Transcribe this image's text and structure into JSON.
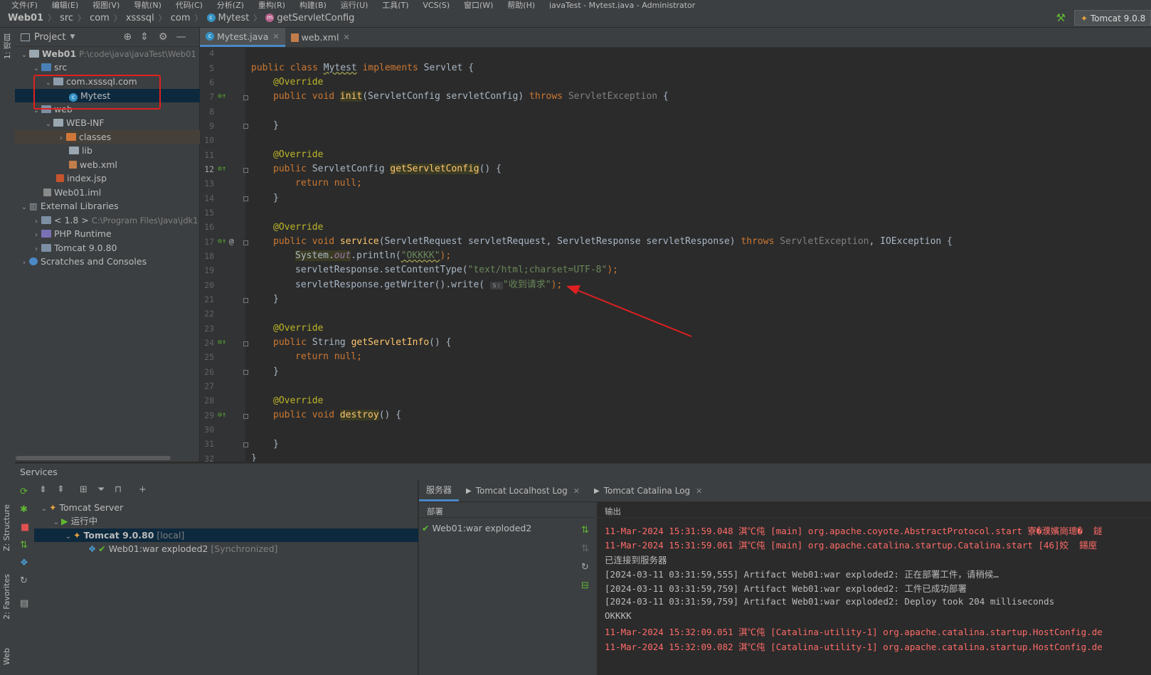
{
  "menubar": {
    "items": [
      "文件(F)",
      "编辑(E)",
      "视图(V)",
      "导航(N)",
      "代码(C)",
      "分析(Z)",
      "重构(R)",
      "构建(B)",
      "运行(U)",
      "工具(T)",
      "VCS(S)",
      "窗口(W)",
      "帮助(H)",
      "javaTest - Mytest.java - Administrator"
    ]
  },
  "breadcrumb": {
    "items": [
      "Web01",
      "src",
      "com",
      "xsssql",
      "com",
      "Mytest",
      "getServletConfig"
    ]
  },
  "run_config": "Tomcat 9.0.8",
  "left_strip": {
    "project_tab": "1: 项目",
    "structure_tab": "Z: Structure",
    "favorites_tab": "2: Favorites",
    "web_tab": "Web"
  },
  "project": {
    "header": "Project",
    "tree": [
      {
        "label": "Web01",
        "path": "P:\\code\\java\\javaTest\\Web01"
      },
      {
        "label": "src"
      },
      {
        "label": "com.xsssql.com"
      },
      {
        "label": "Mytest"
      },
      {
        "label": "web"
      },
      {
        "label": "WEB-INF"
      },
      {
        "label": "classes"
      },
      {
        "label": "lib"
      },
      {
        "label": "web.xml"
      },
      {
        "label": "index.jsp"
      },
      {
        "label": "Web01.iml"
      },
      {
        "label": "External Libraries"
      },
      {
        "label": "< 1.8 >",
        "path": "C:\\Program Files\\Java\\jdk1"
      },
      {
        "label": "PHP Runtime"
      },
      {
        "label": "Tomcat 9.0.80"
      },
      {
        "label": "Scratches and Consoles"
      }
    ]
  },
  "editor": {
    "tabs": [
      {
        "label": "Mytest.java"
      },
      {
        "label": "web.xml"
      }
    ],
    "line_numbers": [
      "4",
      "5",
      "6",
      "7",
      "8",
      "9",
      "10",
      "11",
      "12",
      "13",
      "14",
      "15",
      "16",
      "17",
      "18",
      "19",
      "20",
      "21",
      "22",
      "23",
      "24",
      "25",
      "26",
      "27",
      "28",
      "29",
      "30",
      "31",
      "32"
    ],
    "code": {
      "l5a": "public class ",
      "l5b": "Mytest",
      "l5c": " implements ",
      "l5d": "Servlet {",
      "override": "@Override",
      "l7a": "public void ",
      "l7b": "init",
      "l7c": "(ServletConfig servletConfig) ",
      "l7d": "throws ",
      "l7e": "ServletException",
      "l7f": " {",
      "close": "}",
      "l12a": "public ",
      "l12b": "ServletConfig ",
      "l12c": "getServletConfig",
      "l12d": "() {",
      "ret_null_a": "return ",
      "ret_null_b": "null;",
      "l17a": "public void ",
      "l17b": "service",
      "l17c": "(ServletRequest servletRequest, ServletResponse servletResponse) ",
      "l17d": "throws ",
      "l17e": "ServletException",
      "l17f": ", IOException {",
      "l18a": "System.",
      "l18b": "out",
      "l18c": ".println(",
      "l18d": "\"OKKKK\"",
      "l18e": ");",
      "l19a": "servletResponse.setContentType(",
      "l19b": "\"text/html;charset=UTF-8\"",
      "l19c": ");",
      "l20a": "servletResponse.getWriter().write( ",
      "l20hint": "s:",
      "l20b": "\"收到请求\"",
      "l20c": ");",
      "l24a": "public ",
      "l24b": "String ",
      "l24c": "getServletInfo",
      "l24d": "() {",
      "l29a": "public void ",
      "l29b": "destroy",
      "l29c": "() {"
    }
  },
  "services": {
    "title": "Services",
    "tree": [
      {
        "label": "Tomcat Server"
      },
      {
        "label": "运行中"
      },
      {
        "label": "Tomcat 9.0.80",
        "suffix": "[local]"
      },
      {
        "label": "Web01:war exploded2",
        "suffix": "[Synchronized]"
      }
    ],
    "output_tabs": [
      "服务器",
      "Tomcat Localhost Log",
      "Tomcat Catalina Log"
    ],
    "deploy_header": "部署",
    "deploy_item": "Web01:war exploded2",
    "output_header": "输出",
    "output_lines": [
      {
        "text": "11-Mar-2024 15:31:59.048 淇℃伅 [main] org.apache.coyote.AbstractProtocol.start 寮�濮嬪崗璁�  鐩",
        "type": "err"
      },
      {
        "text": "11-Mar-2024 15:31:59.061 淇℃伅 [main] org.apache.catalina.startup.Catalina.start [46]姣  鍚庢",
        "type": "err"
      },
      {
        "text": "已连接到服务器",
        "type": "info"
      },
      {
        "text": "[2024-03-11 03:31:59,555] Artifact Web01:war exploded2: 正在部署工件，请稍候…",
        "type": "info"
      },
      {
        "text": "[2024-03-11 03:31:59,759] Artifact Web01:war exploded2: 工件已成功部署",
        "type": "info"
      },
      {
        "text": "[2024-03-11 03:31:59,759] Artifact Web01:war exploded2: Deploy took 204 milliseconds",
        "type": "info"
      },
      {
        "text": "OKKKK",
        "type": "info"
      },
      {
        "text": "11-Mar-2024 15:32:09.051 淇℃伅 [Catalina-utility-1] org.apache.catalina.startup.HostConfig.de",
        "type": "err"
      },
      {
        "text": "11-Mar-2024 15:32:09.082 淇℃伅 [Catalina-utility-1] org.apache.catalina.startup.HostConfig.de",
        "type": "err"
      }
    ]
  },
  "colors": {
    "annotation_red": "#e02020",
    "selection": "#0d293e",
    "accent": "#4a88c7"
  }
}
